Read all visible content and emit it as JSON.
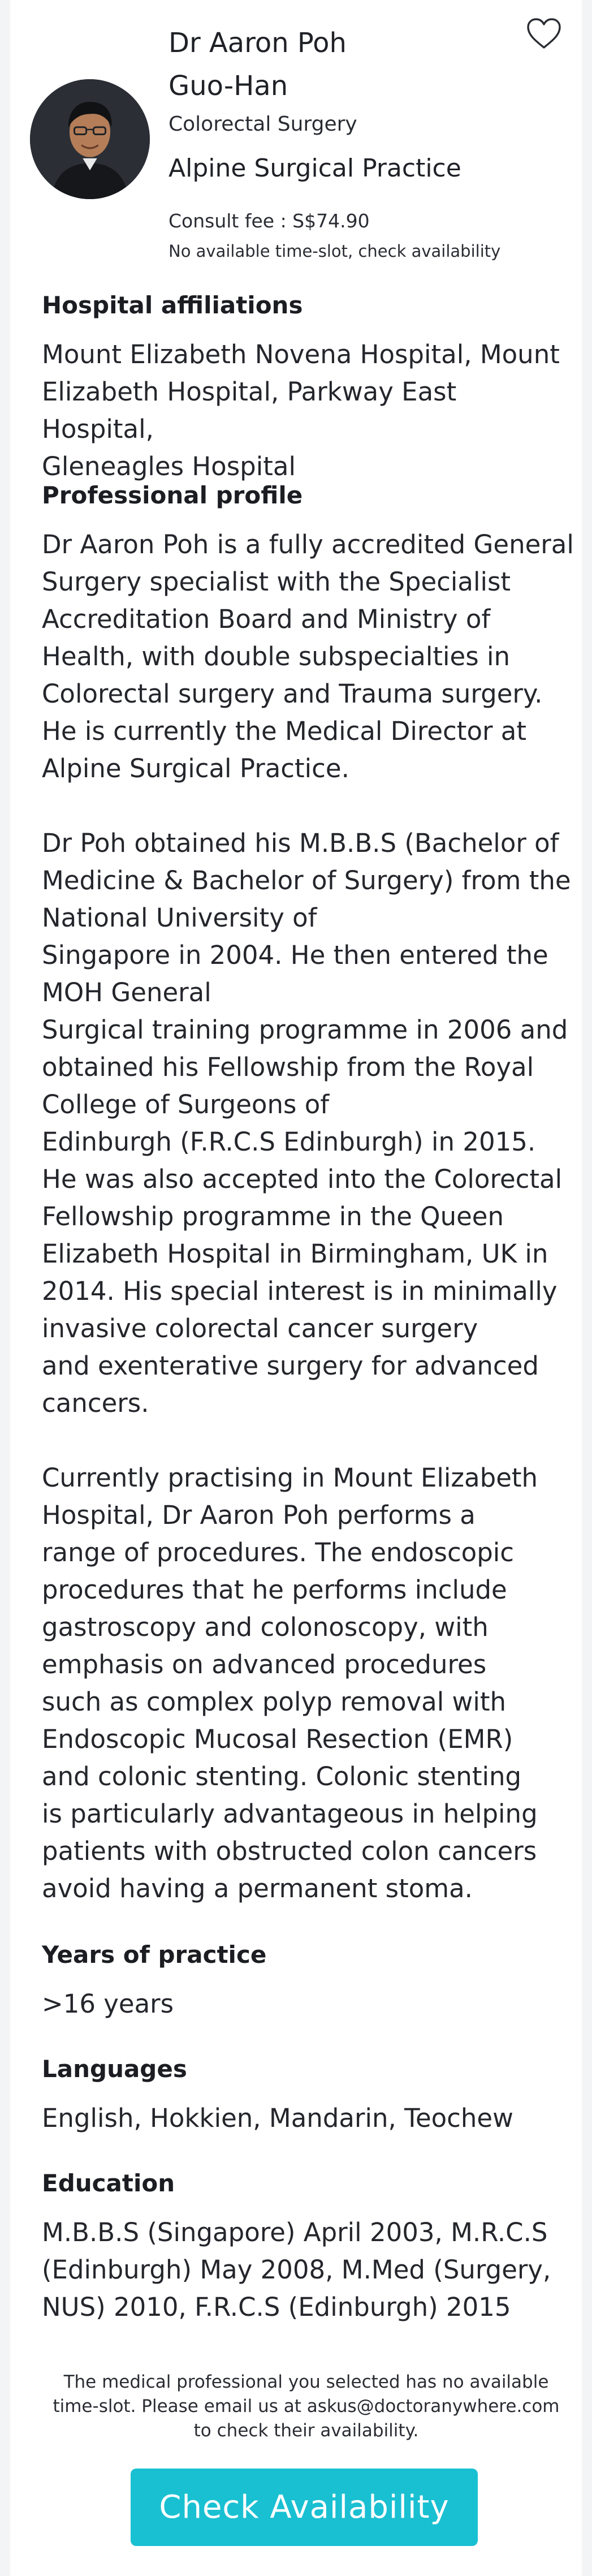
{
  "doctor": {
    "name_line1": "Dr Aaron Poh",
    "name_line2": "Guo-Han",
    "specialty": "Colorectal Surgery",
    "practice": "Alpine Surgical Practice",
    "consult_fee": "Consult fee : S$74.90",
    "availability_note": "No available time-slot, check availability",
    "favorite_icon": "heart-outline-icon"
  },
  "affiliations": {
    "heading": "Hospital affiliations",
    "lines": [
      "Mount Elizabeth Novena Hospital, Mount",
      "Elizabeth Hospital, Parkway East Hospital,",
      "Gleneagles Hospital"
    ]
  },
  "profile": {
    "heading": "Professional profile",
    "paragraphs": [
      [
        "Dr Aaron Poh is a fully accredited General",
        "Surgery specialist with the Specialist",
        "Accreditation Board and Ministry of",
        "Health, with double subspecialties in",
        "Colorectal surgery and Trauma surgery.",
        "He is currently the Medical Director at",
        "Alpine Surgical Practice."
      ],
      [
        "Dr Poh obtained his M.B.B.S (Bachelor of",
        "Medicine & Bachelor of Surgery) from the",
        "National University of",
        "Singapore in 2004. He then entered the",
        "MOH General",
        "Surgical training programme in 2006 and",
        "obtained his Fellowship from the Royal",
        "College of Surgeons of",
        "Edinburgh (F.R.C.S Edinburgh) in 2015.",
        "He was also accepted into the Colorectal",
        "Fellowship programme in the Queen",
        "Elizabeth Hospital in Birmingham, UK in",
        "2014. His special interest is in minimally",
        "invasive colorectal cancer surgery",
        "and exenterative surgery for advanced",
        "cancers."
      ],
      [
        "Currently practising in Mount Elizabeth",
        "Hospital, Dr Aaron Poh performs a",
        "range of procedures. The endoscopic",
        "procedures that he performs include",
        "gastroscopy and colonoscopy, with",
        "emphasis on advanced procedures",
        "such as complex polyp removal with",
        "Endoscopic Mucosal Resection (EMR)",
        "and colonic stenting. Colonic stenting",
        "is particularly advantageous in helping",
        "patients with obstructed colon cancers",
        "avoid having a permanent stoma."
      ]
    ]
  },
  "experience": {
    "heading": "Years of practice",
    "value": ">16 years"
  },
  "languages": {
    "heading": "Languages",
    "value": "English, Hokkien, Mandarin, Teochew"
  },
  "education": {
    "heading": "Education",
    "lines": [
      "M.B.B.S (Singapore) April 2003, M.R.C.S",
      "(Edinburgh) May 2008, M.Med (Surgery,",
      "NUS) 2010, F.R.C.S (Edinburgh) 2015"
    ]
  },
  "footer": {
    "note_lines": [
      "The medical professional you selected has no available",
      "time-slot. Please email us at askus@doctoranywhere.com",
      "to check their availability."
    ],
    "cta_label": "Check Availability"
  },
  "colors": {
    "accent": "#19c0d2",
    "text": "#1f2127",
    "background": "#f3f4f5"
  }
}
